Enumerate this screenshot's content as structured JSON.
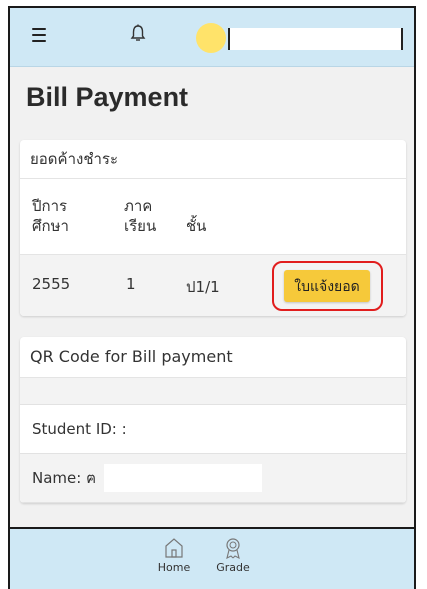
{
  "header": {
    "menu_icon": "hamburger-menu-icon",
    "bell_icon": "bell-icon",
    "avatar_color": "#ffe36a"
  },
  "page": {
    "title": "Bill Payment"
  },
  "outstanding": {
    "title": "ยอดค้างชำระ",
    "columns": {
      "year": "ปีการ\nศึกษา",
      "term": "ภาค\nเรียน",
      "grade": "ชั้น"
    },
    "rows": [
      {
        "year": "2555",
        "term": "1",
        "grade": "ป1/1",
        "button_label": "ใบแจ้งยอด"
      }
    ]
  },
  "qr": {
    "title": "QR Code for Bill payment",
    "student_id_label": "Student ID: :",
    "name_label": "Name: ฅ"
  },
  "bottom_nav": [
    {
      "label": "Home",
      "icon": "home-icon"
    },
    {
      "label": "Grade",
      "icon": "award-icon"
    }
  ],
  "colors": {
    "topbar": "#cfe8f5",
    "button": "#f6c93a",
    "highlight": "#e11d1d"
  }
}
